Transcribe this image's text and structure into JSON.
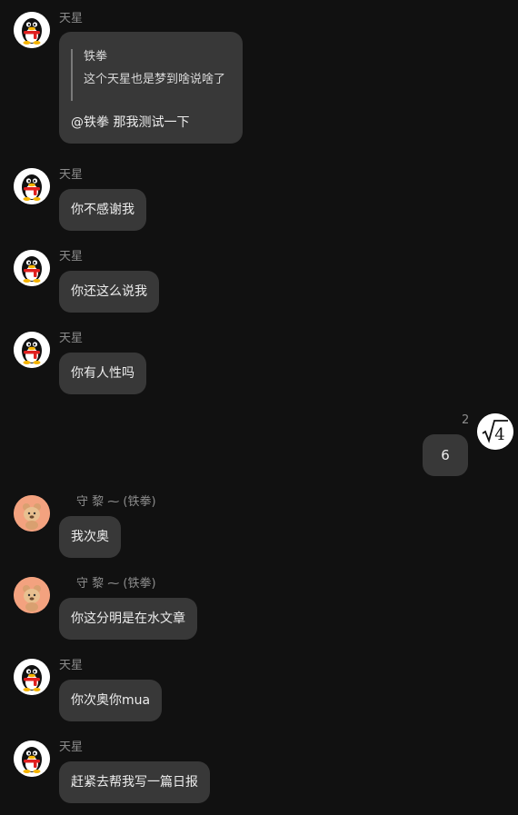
{
  "messages": [
    {
      "sender": "天星",
      "quote_author": "铁拳",
      "quote_text": "这个天星也是梦到啥说啥了",
      "text": "@铁拳 那我测试一下"
    },
    {
      "sender": "天星",
      "text": "你不感谢我"
    },
    {
      "sender": "天星",
      "text": "你还这么说我"
    },
    {
      "sender": "天星",
      "text": "你有人性吗"
    },
    {
      "sender_level": "2",
      "text": "6",
      "self_avatar_glyph": "√4"
    },
    {
      "sender": "守 黎 ⁓ (铁拳)",
      "text": "我次奥"
    },
    {
      "sender": "守 黎 ⁓ (铁拳)",
      "text": "你这分明是在水文章"
    },
    {
      "sender": "天星",
      "text": "你次奥你mua"
    },
    {
      "sender": "天星",
      "text": "赶紧去帮我写一篇日报"
    }
  ],
  "icons": {
    "qq_avatar": "penguin-avatar-icon",
    "bear_avatar": "bear-avatar-icon",
    "sqrt_avatar": "sqrt-avatar-icon"
  },
  "colors": {
    "background": "#111111",
    "bubble": "#383838",
    "sender_text": "#8c8c8c"
  }
}
